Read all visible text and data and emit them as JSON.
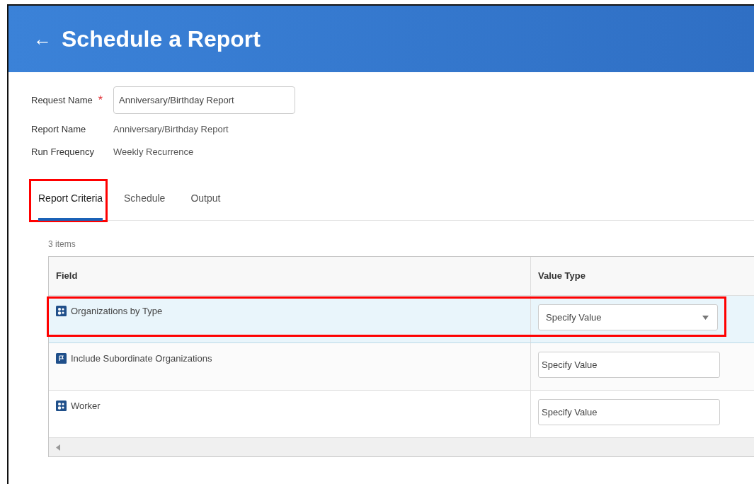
{
  "header": {
    "back": "←",
    "title": "Schedule a Report"
  },
  "form": [
    {
      "kind": "input",
      "label": "Request Name",
      "required": true,
      "value": "Anniversary/Birthday Report"
    },
    {
      "kind": "text",
      "label": "Report Name",
      "value": "Anniversary/Birthday Report"
    },
    {
      "kind": "text",
      "label": "Run Frequency",
      "value": "Weekly Recurrence"
    }
  ],
  "required_mark": "*",
  "tabs": [
    {
      "label": "Report Criteria",
      "selected": true,
      "highlighted": true
    },
    {
      "label": "Schedule",
      "selected": false,
      "highlighted": false
    },
    {
      "label": "Output",
      "selected": false,
      "highlighted": false
    }
  ],
  "table": {
    "count": "3 items",
    "columns": [
      "Field",
      "Value Type"
    ],
    "rows": [
      {
        "field": "Organizations by Type",
        "value": "Specify Value",
        "kind": "dropdown",
        "selected": true,
        "highlighted": true
      },
      {
        "field": "Include Subordinate Organizations",
        "value": "Specify Value",
        "kind": "input",
        "selected": false,
        "highlighted": false
      },
      {
        "field": "Worker",
        "value": "Specify Value",
        "kind": "input",
        "selected": false,
        "highlighted": false
      }
    ]
  }
}
